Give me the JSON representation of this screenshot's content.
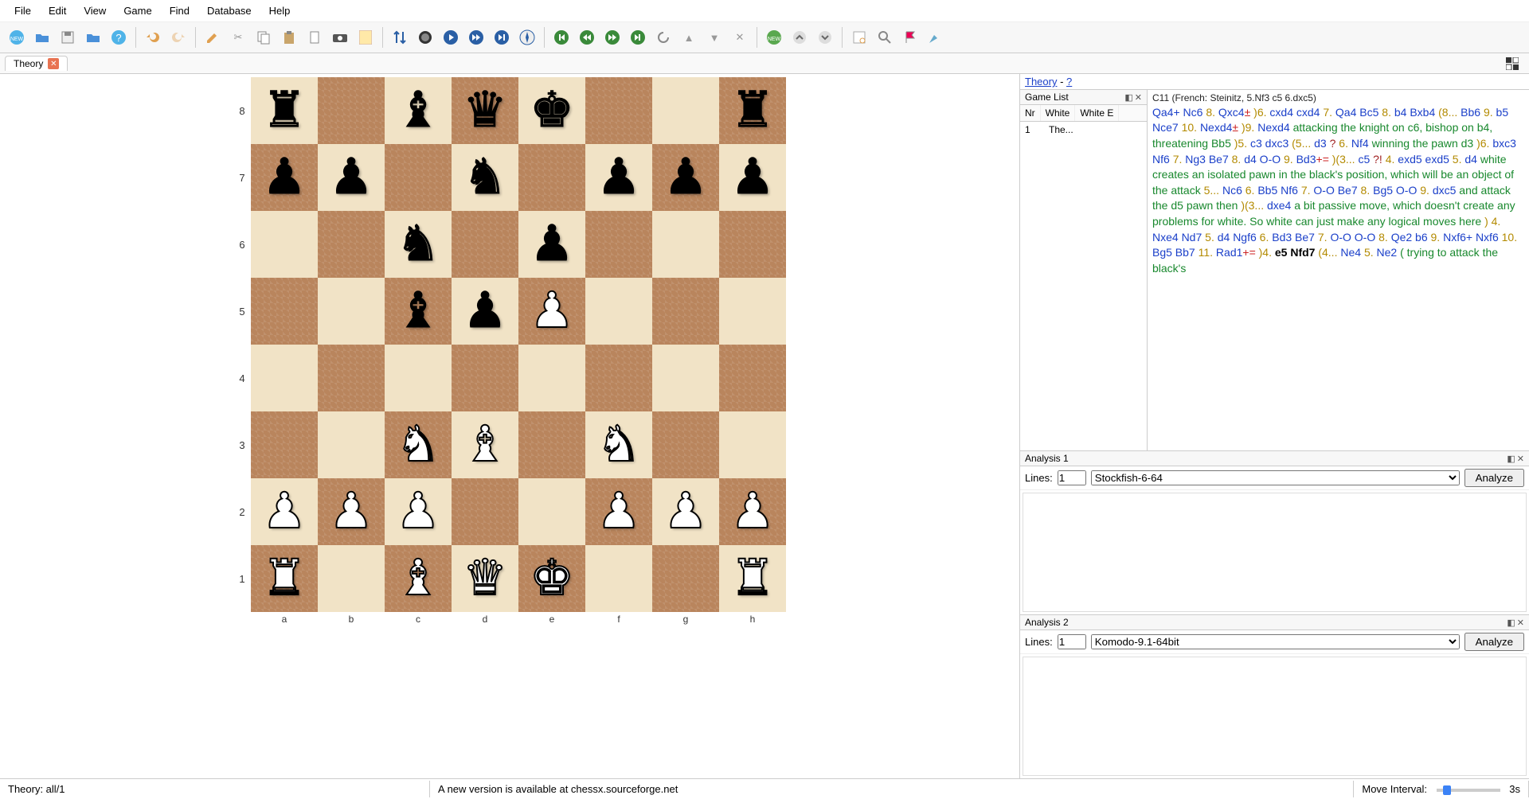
{
  "menu": [
    "File",
    "Edit",
    "View",
    "Game",
    "Find",
    "Database",
    "Help"
  ],
  "tab": {
    "label": "Theory"
  },
  "board": {
    "ranks": [
      "8",
      "7",
      "6",
      "5",
      "4",
      "3",
      "2",
      "1"
    ],
    "files": [
      "a",
      "b",
      "c",
      "d",
      "e",
      "f",
      "g",
      "h"
    ],
    "pieces": {
      "a8": "br",
      "c8": "bb",
      "d8": "bq",
      "e8": "bk",
      "h8": "br",
      "a7": "bp",
      "b7": "bp",
      "d7": "bn",
      "f7": "bp",
      "g7": "bp",
      "h7": "bp",
      "c6": "bn",
      "e6": "bp",
      "c5": "bb",
      "d5": "bp",
      "e5": "wp",
      "c3": "wn",
      "d3": "wb",
      "f3": "wn",
      "a2": "wp",
      "b2": "wp",
      "c2": "wp",
      "f2": "wp",
      "g2": "wp",
      "h2": "wp",
      "a1": "wr",
      "c1": "wb",
      "d1": "wq",
      "e1": "wk",
      "h1": "wr"
    }
  },
  "gamelist": {
    "title": "Game List",
    "headers": [
      "Nr",
      "White",
      "White E"
    ],
    "rows": [
      {
        "nr": "1",
        "white": "The..."
      }
    ]
  },
  "theory": {
    "link": "Theory",
    "sep": " - ",
    "q": "?"
  },
  "opening": "C11 (French: Steinitz, 5.Nf3 c5 6.dxc5)",
  "notation_segments": [
    {
      "t": "Qa4+ Nc6 ",
      "c": "blue"
    },
    {
      "t": "8. ",
      "c": ""
    },
    {
      "t": "Qxc4",
      "c": "blue"
    },
    {
      "t": "±",
      "c": "pm"
    },
    {
      "t": " )6. ",
      "c": ""
    },
    {
      "t": "cxd4 cxd4 ",
      "c": "blue"
    },
    {
      "t": "7. ",
      "c": ""
    },
    {
      "t": "Qa4 Bc5 ",
      "c": "blue"
    },
    {
      "t": "8. ",
      "c": ""
    },
    {
      "t": "b4 Bxb4 ",
      "c": "blue"
    },
    {
      "t": "(8... ",
      "c": ""
    },
    {
      "t": "Bb6 ",
      "c": "blue"
    },
    {
      "t": "9. ",
      "c": ""
    },
    {
      "t": "b5 Nce7 ",
      "c": "blue"
    },
    {
      "t": "10. ",
      "c": ""
    },
    {
      "t": "Nexd4",
      "c": "blue"
    },
    {
      "t": "±",
      "c": "pm"
    },
    {
      "t": " )9. ",
      "c": ""
    },
    {
      "t": "Nexd4 ",
      "c": "blue"
    },
    {
      "t": "attacking the knight on c6, bishop on b4, threatening Bb5 ",
      "c": "green"
    },
    {
      "t": ")5. ",
      "c": ""
    },
    {
      "t": "c3 dxc3 ",
      "c": "blue"
    },
    {
      "t": "(5... ",
      "c": ""
    },
    {
      "t": "d3",
      "c": "blue"
    },
    {
      "t": " ? ",
      "c": "darkred"
    },
    {
      "t": "6. ",
      "c": ""
    },
    {
      "t": "Nf4 ",
      "c": "blue"
    },
    {
      "t": "winning the pawn d3 ",
      "c": "green"
    },
    {
      "t": ")6. ",
      "c": ""
    },
    {
      "t": "bxc3 Nf6 ",
      "c": "blue"
    },
    {
      "t": "7. ",
      "c": ""
    },
    {
      "t": "Ng3 Be7 ",
      "c": "blue"
    },
    {
      "t": "8. ",
      "c": ""
    },
    {
      "t": "d4 O-O ",
      "c": "blue"
    },
    {
      "t": "9. ",
      "c": ""
    },
    {
      "t": "Bd3",
      "c": "blue"
    },
    {
      "t": "+=",
      "c": "pm"
    },
    {
      "t": " )(3... ",
      "c": ""
    },
    {
      "t": "c5",
      "c": "blue"
    },
    {
      "t": " ?! ",
      "c": "darkred"
    },
    {
      "t": "4. ",
      "c": ""
    },
    {
      "t": "exd5 exd5 ",
      "c": "blue"
    },
    {
      "t": "5. ",
      "c": ""
    },
    {
      "t": "d4 ",
      "c": "blue"
    },
    {
      "t": "white creates an isolated pawn in the black's position, which will be an object of the attack ",
      "c": "green"
    },
    {
      "t": "5... ",
      "c": ""
    },
    {
      "t": "Nc6 ",
      "c": "blue"
    },
    {
      "t": "6. ",
      "c": ""
    },
    {
      "t": "Bb5 Nf6 ",
      "c": "blue"
    },
    {
      "t": "7. ",
      "c": ""
    },
    {
      "t": "O-O Be7 ",
      "c": "blue"
    },
    {
      "t": "8. ",
      "c": ""
    },
    {
      "t": "Bg5 O-O ",
      "c": "blue"
    },
    {
      "t": "9. ",
      "c": ""
    },
    {
      "t": "dxc5 ",
      "c": "blue"
    },
    {
      "t": "and attack the d5 pawn then ",
      "c": "green"
    },
    {
      "t": ")(3... ",
      "c": ""
    },
    {
      "t": "dxe4 ",
      "c": "blue"
    },
    {
      "t": "a bit passive move, which doesn't create any problems for white. So white can just make any logical moves here ",
      "c": "green"
    },
    {
      "t": ") 4. ",
      "c": ""
    },
    {
      "t": "Nxe4 Nd7 ",
      "c": "blue"
    },
    {
      "t": "5. ",
      "c": ""
    },
    {
      "t": "d4 Ngf6 ",
      "c": "blue"
    },
    {
      "t": "6. ",
      "c": ""
    },
    {
      "t": "Bd3 Be7 ",
      "c": "blue"
    },
    {
      "t": "7. ",
      "c": ""
    },
    {
      "t": "O-O O-O ",
      "c": "blue"
    },
    {
      "t": "8. ",
      "c": ""
    },
    {
      "t": "Qe2 b6 ",
      "c": "blue"
    },
    {
      "t": "9. ",
      "c": ""
    },
    {
      "t": "Nxf6+ Nxf6 ",
      "c": "blue"
    },
    {
      "t": "10. ",
      "c": ""
    },
    {
      "t": "Bg5 Bb7 ",
      "c": "blue"
    },
    {
      "t": "11. ",
      "c": ""
    },
    {
      "t": "Rad1",
      "c": "blue"
    },
    {
      "t": "+=",
      "c": "pm"
    },
    {
      "t": " )4. ",
      "c": ""
    },
    {
      "t": "e5 ",
      "c": "bold"
    },
    {
      "t": "Nfd7 ",
      "c": "bold"
    },
    {
      "t": "(4... ",
      "c": ""
    },
    {
      "t": "Ne4 ",
      "c": "blue"
    },
    {
      "t": "5. ",
      "c": ""
    },
    {
      "t": "Ne2 ",
      "c": "blue"
    },
    {
      "t": "( trying to attack the black's",
      "c": "green"
    }
  ],
  "analysis1": {
    "title": "Analysis 1",
    "lines_label": "Lines:",
    "lines": "1",
    "engine": "Stockfish-6-64",
    "button": "Analyze"
  },
  "analysis2": {
    "title": "Analysis 2",
    "lines_label": "Lines:",
    "lines": "1",
    "engine": "Komodo-9.1-64bit",
    "button": "Analyze"
  },
  "status": {
    "left": "Theory: all/1",
    "mid": "A new version is available at chessx.sourceforge.net",
    "interval_label": "Move Interval:",
    "interval_value": "3s"
  },
  "glyph": {
    "br": "♜",
    "bn": "♞",
    "bb": "♝",
    "bq": "♛",
    "bk": "♚",
    "bp": "♟",
    "wr": "♜",
    "wn": "♞",
    "wb": "♝",
    "wq": "♛",
    "wk": "♚",
    "wp": "♟"
  }
}
